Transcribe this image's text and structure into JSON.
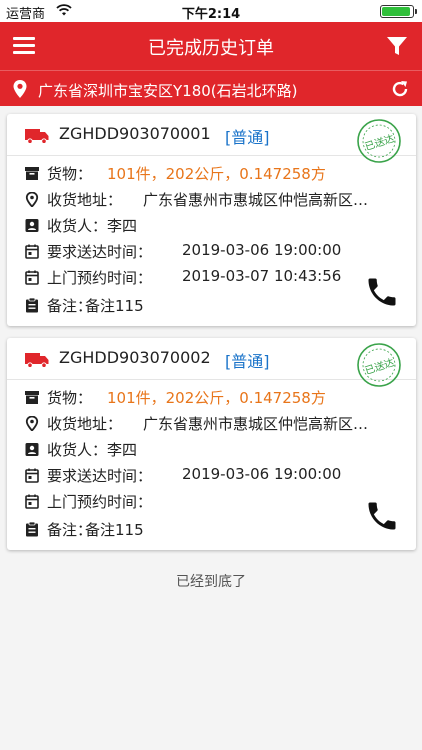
{
  "status_bar": {
    "carrier": "运营商",
    "time": "下午2:14",
    "battery_color": "#2fbf3a"
  },
  "nav": {
    "title": "已完成历史订单",
    "bg_color": "#e0262b"
  },
  "location": {
    "address": "广东省深圳市宝安区Y180(石岩北环路)"
  },
  "orders": [
    {
      "order_no": "ZGHDD903070001",
      "level": "[普通]",
      "stamp_text": "已送达",
      "goods_label": "货物：",
      "goods_value": "101件，202公斤，0.147258方",
      "address_label": "收货地址：",
      "address_value": "广东省惠州市惠城区仲恺高新区…",
      "receiver_label": "收货人：",
      "receiver_value": "李四",
      "deadline_label": "要求送达时间：",
      "deadline_value": "2019-03-06 19:00:00",
      "visit_label": "上门预约时间：",
      "visit_value": "2019-03-07 10:43:56",
      "note_label": "备注：",
      "note_value": "备注115"
    },
    {
      "order_no": "ZGHDD903070002",
      "level": "[普通]",
      "stamp_text": "已送达",
      "goods_label": "货物：",
      "goods_value": "101件，202公斤，0.147258方",
      "address_label": "收货地址：",
      "address_value": "广东省惠州市惠城区仲恺高新区…",
      "receiver_label": "收货人：",
      "receiver_value": "李四",
      "deadline_label": "要求送达时间：",
      "deadline_value": "2019-03-06 19:00:00",
      "visit_label": "上门预约时间：",
      "visit_value": "",
      "note_label": "备注：",
      "note_value": "备注115"
    }
  ],
  "footer": {
    "end_text": "已经到底了"
  },
  "colors": {
    "accent": "#e0262b",
    "goods_value": "#e8751a",
    "level": "#1a73c9",
    "stamp": "#3aa34a"
  }
}
